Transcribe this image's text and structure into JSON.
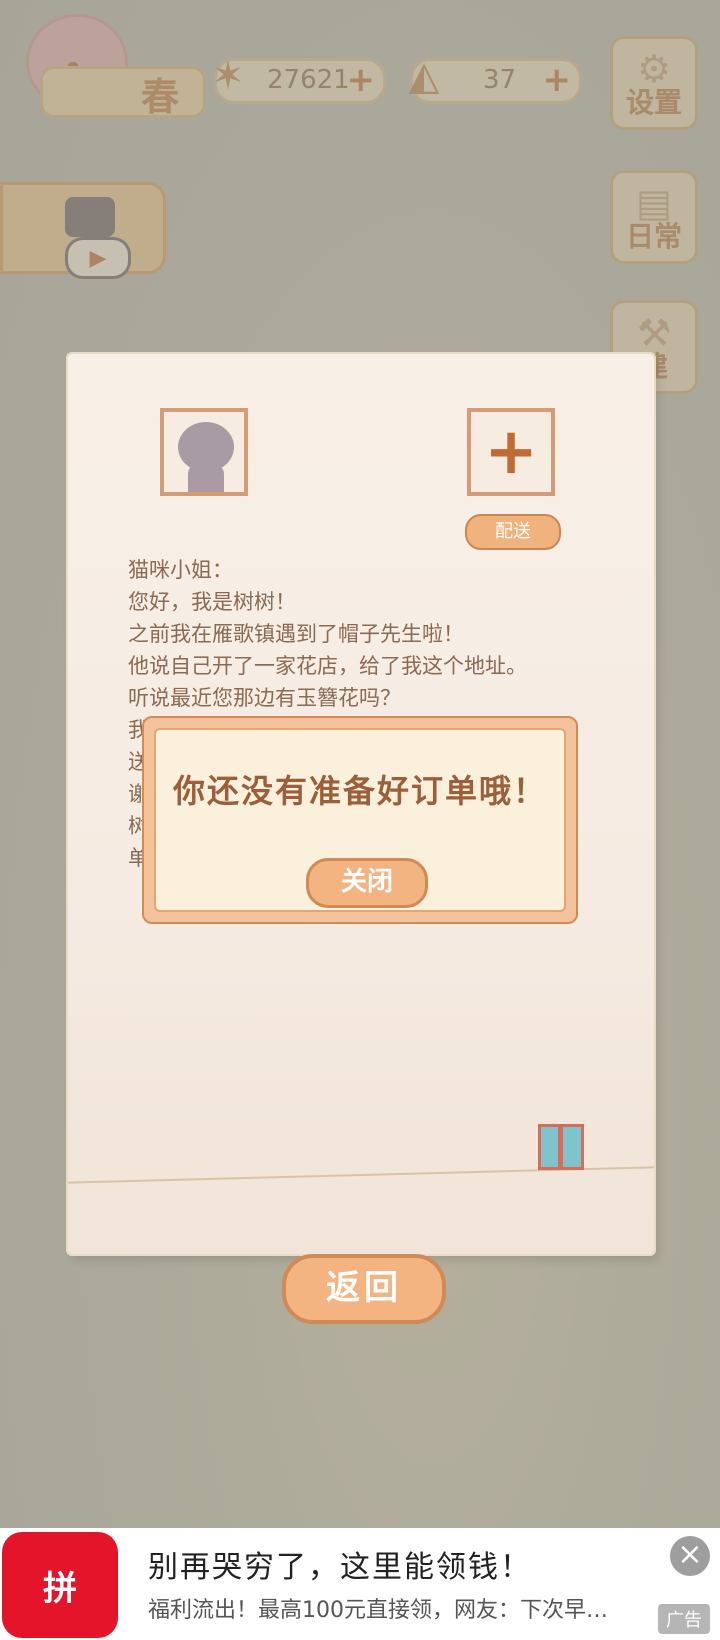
{
  "hud": {
    "season_label": "春",
    "fish_count": "27621",
    "cheese_count": "37",
    "plus_symbol": "+",
    "settings_label": "设置",
    "daily_label": "日常",
    "build_label": "建"
  },
  "letter": {
    "deliver_label": "配送",
    "lines": [
      "猫咪小姐：",
      "您好，我是树树！",
      "之前我在雁歌镇遇到了帽子先生啦！",
      "他说自己开了一家花店，给了我这个地址。",
      "听说最近您那边有玉簪花吗？",
      "我",
      "送",
      "谢",
      "树",
      "单"
    ],
    "back_label": "返回"
  },
  "modal": {
    "message": "你还没有准备好订单哦！",
    "close_label": "关闭"
  },
  "ad": {
    "logo_text": "拼",
    "title": "别再哭穷了，这里能领钱！",
    "description": "福利流出！最高100元直接领，网友：下次早…",
    "close_symbol": "×",
    "ad_tag": "广告"
  }
}
